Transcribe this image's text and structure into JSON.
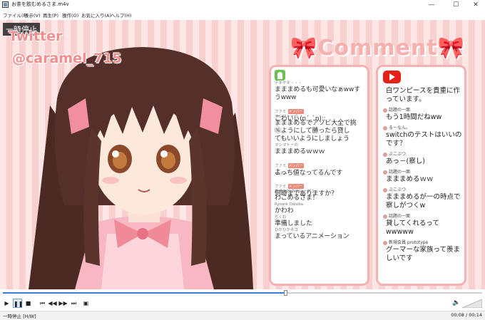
{
  "window": {
    "title": "お茶を飲むめるさま.m4v",
    "minimize_glyph": "—",
    "maximize_glyph": "☐",
    "close_glyph": "✕"
  },
  "menu": [
    "ファイル(F)",
    "表示(V)",
    "再生(P)",
    "操作(O)",
    "お気に入り(A)",
    "ヘルプ(H)"
  ],
  "video": {
    "pause_tag": "一時停止",
    "twitter_label": "Twitter",
    "twitter_handle": "@caramel_715",
    "comment_title": "🎀Comment🎀"
  },
  "left_comments": [
    {
      "name": "テキヤキ・・・",
      "text": "まままめるも可愛いなぁwwす",
      "badge": ""
    },
    {
      "name": "",
      "text": "うwww",
      "badge": ""
    },
    {
      "name": "ファミ",
      "text": "こわいぃ(n´_`n)::",
      "badge": "メンバー"
    },
    {
      "name": "マシマトーの",
      "text": "まままめるでアソビ大全で挑",
      "badge": ""
    },
    {
      "name": "",
      "text": "⑯ようにして勝ったら貸し",
      "badge": ""
    },
    {
      "name": "",
      "text": "てもいいようにしましょう",
      "badge": ""
    },
    {
      "name": "マシマトーの",
      "text": "まままめるｗｗｗ",
      "badge": ""
    },
    {
      "name": "ファミ",
      "text": "こっち値なってるんです",
      "badge": "メンバー"
    },
    {
      "name": "",
      "text": "よ…",
      "badge": ""
    },
    {
      "name": "ファミ",
      "text": "何時までありますか？",
      "badge": "メンバー"
    },
    {
      "name": "株式会社 おれいーゲン",
      "text": "わこめるさま！",
      "badge": ""
    },
    {
      "name": "Ryoark Daloba",
      "text": "かわわ",
      "badge": ""
    },
    {
      "name": "ちくわ",
      "text": "準備しました",
      "badge": ""
    },
    {
      "name": "ひかひかネコ",
      "text": "まっているアニメーション",
      "badge": ""
    }
  ],
  "right_comments": [
    {
      "name": "",
      "text": "白ワンピースを貴重に作っています。"
    },
    {
      "name": "話題の一面",
      "text": "もう1時間だねww"
    },
    {
      "name": "るーなん。",
      "text": "switchのテストはいいのです？"
    },
    {
      "name": "ぶこぶつ",
      "text": "あっ－(察し)"
    },
    {
      "name": "話題の一面",
      "text": "まままめるｗｗ"
    },
    {
      "name": "ぶこぶつ",
      "text": "まままめるが一の時点で察しがつくw"
    },
    {
      "name": "話題の一面",
      "text": "貸してくれるって wwwww"
    },
    {
      "name": "新規会員 prototype",
      "text": "グーマーな家族って羨ましいです"
    }
  ],
  "player": {
    "progress": 0.59,
    "status": "一時停止 [H/W]",
    "time": "00:08 / 00:14",
    "controls": [
      "▶",
      "❚❚",
      "■",
      "⏮",
      "◀◀",
      "▶▶",
      "⏭",
      "▣"
    ]
  },
  "colors": {
    "accent_pink": "#f4b2b2",
    "youtube_red": "#e62117",
    "progress_blue": "#3b7bd4"
  }
}
